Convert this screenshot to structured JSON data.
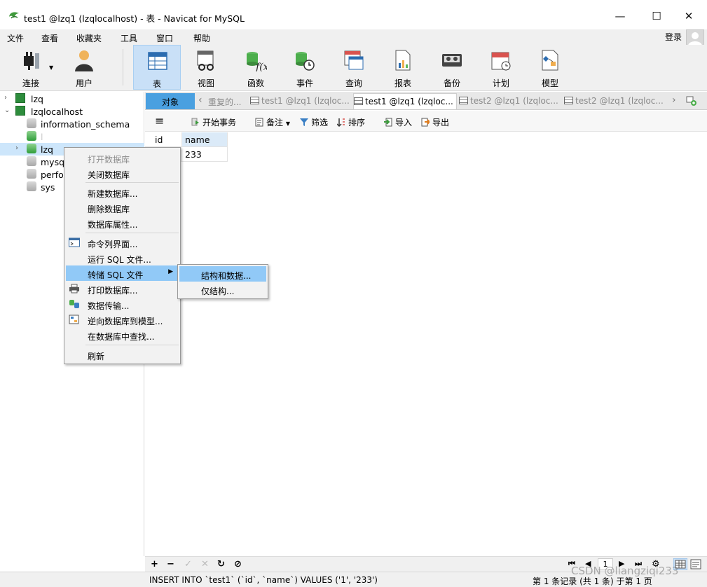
{
  "window": {
    "title": "test1 @lzq1 (lzqlocalhost) - 表 - Navicat for MySQL",
    "minimize": "—",
    "maximize": "☐",
    "close": "✕"
  },
  "menubar": {
    "items": [
      "文件",
      "查看",
      "收藏夹",
      "工具",
      "窗口",
      "帮助"
    ],
    "login": "登录"
  },
  "toolbar": {
    "items": [
      {
        "label": "连接",
        "icon": "plug-icon"
      },
      {
        "label": "用户",
        "icon": "user-icon"
      },
      {
        "label": "表",
        "icon": "table-icon"
      },
      {
        "label": "视图",
        "icon": "view-icon"
      },
      {
        "label": "函数",
        "icon": "function-icon"
      },
      {
        "label": "事件",
        "icon": "event-icon"
      },
      {
        "label": "查询",
        "icon": "query-icon"
      },
      {
        "label": "报表",
        "icon": "report-icon"
      },
      {
        "label": "备份",
        "icon": "backup-icon"
      },
      {
        "label": "计划",
        "icon": "schedule-icon"
      },
      {
        "label": "模型",
        "icon": "model-icon"
      }
    ],
    "active": "表"
  },
  "tree": {
    "items": [
      {
        "label": "lzq"
      },
      {
        "label": "lzqlocalhost"
      },
      {
        "label": "information_schema"
      },
      {
        "label": "l"
      },
      {
        "label": "lzq"
      },
      {
        "label": "mysql"
      },
      {
        "label": "perfo"
      },
      {
        "label": "sys"
      }
    ]
  },
  "tabs": {
    "objects": "对象",
    "items": [
      {
        "label": "重复的..."
      },
      {
        "label": "test1 @lzq1 (lzqloc..."
      },
      {
        "label": "test1 @lzq1 (lzqloc..."
      },
      {
        "label": "test2 @lzq1 (lzqloc..."
      },
      {
        "label": "test2 @lzq1 (lzqloc..."
      }
    ]
  },
  "subbar": {
    "menu": "≡",
    "begin_transaction": "开始事务",
    "note": "备注",
    "filter": "筛选",
    "sort": "排序",
    "import": "导入",
    "export": "导出"
  },
  "grid": {
    "columns": [
      "id",
      "name"
    ],
    "rows": [
      [
        "",
        "233"
      ]
    ]
  },
  "context_menu": {
    "items": [
      {
        "label": "打开数据库",
        "disabled": true
      },
      {
        "label": "关闭数据库"
      },
      {
        "label": "新建数据库..."
      },
      {
        "label": "删除数据库"
      },
      {
        "label": "数据库属性..."
      },
      {
        "label": "命令列界面..."
      },
      {
        "label": "运行 SQL 文件..."
      },
      {
        "label": "转储 SQL 文件"
      },
      {
        "label": "打印数据库..."
      },
      {
        "label": "数据传输..."
      },
      {
        "label": "逆向数据库到模型..."
      },
      {
        "label": "在数据库中查找..."
      },
      {
        "label": "刷新"
      }
    ],
    "submenu": [
      "结构和数据...",
      "仅结构..."
    ]
  },
  "bottombar": {
    "add": "+",
    "remove": "−",
    "apply": "✓",
    "discard": "✕",
    "refresh": "↻",
    "stop": "⊘",
    "page": "1"
  },
  "status": {
    "sql": "INSERT INTO `test1` (`id`, `name`) VALUES ('1', '233')",
    "count": "第 1 条记录 (共 1 条) 于第 1 页",
    "watermark": "CSDN @liangziqi233"
  }
}
